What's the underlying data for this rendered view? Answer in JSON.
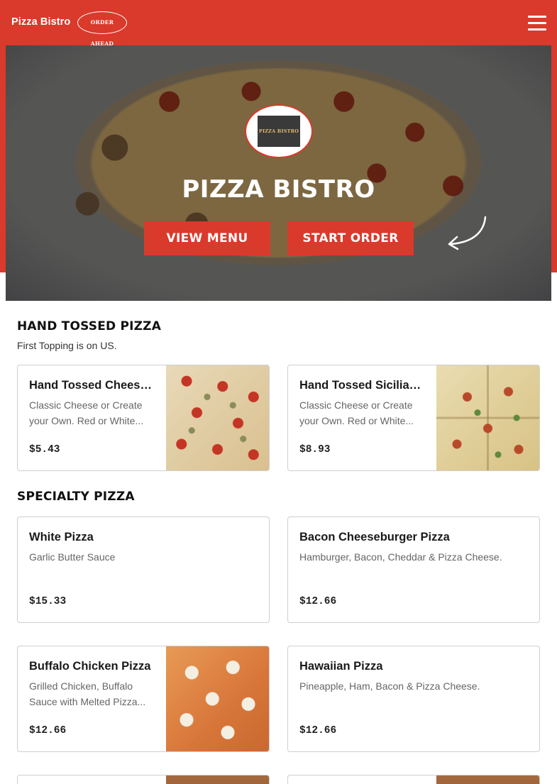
{
  "header": {
    "brand": "Pizza Bistro",
    "order_ahead": "ORDER AHEAD",
    "menu_icon": "hamburger-menu-icon",
    "color": "#d93a2b"
  },
  "hero": {
    "logo_text": "PIZZA BISTRO",
    "title": "PIZZA BISTRO",
    "view_menu": "VIEW MENU",
    "start_order": "START ORDER"
  },
  "sections": [
    {
      "title": "HAND TOSSED PIZZA",
      "subtitle": "First Topping is on US.",
      "items": [
        {
          "name": "Hand Tossed Cheese...",
          "desc": "Classic Cheese or Create your Own. Red or White...",
          "price": "$5.43"
        },
        {
          "name": "Hand Tossed Sicilian...",
          "desc": "Classic Cheese or Create your Own. Red or White...",
          "price": "$8.93"
        }
      ]
    },
    {
      "title": "SPECIALTY PIZZA",
      "items": [
        {
          "name": "White Pizza",
          "desc": "Garlic Butter Sauce",
          "price": "$15.33"
        },
        {
          "name": "Bacon Cheeseburger Pizza",
          "desc": "Hamburger, Bacon, Cheddar & Pizza Cheese.",
          "price": "$12.66"
        },
        {
          "name": "Buffalo Chicken Pizza",
          "desc": "Grilled Chicken, Buffalo Sauce with Melted Pizza...",
          "price": "$12.66"
        },
        {
          "name": "Hawaiian Pizza",
          "desc": "Pineapple, Ham, Bacon & Pizza Cheese.",
          "price": "$12.66"
        }
      ]
    }
  ]
}
